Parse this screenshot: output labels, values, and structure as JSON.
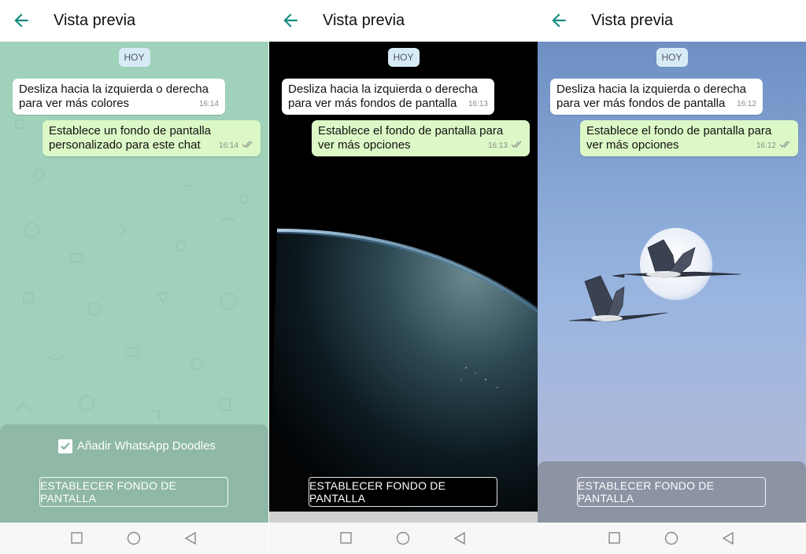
{
  "header": {
    "title": "Vista previa"
  },
  "day_chip": "HOY",
  "panels": [
    {
      "incoming": {
        "line1": "Desliza hacia la izquierda o derecha",
        "line2": "para ver más colores",
        "time": "16:14"
      },
      "outgoing": {
        "line1": "Establece un fondo de pantalla",
        "line2": "personalizado para este chat",
        "time": "16:14"
      },
      "doodles_label": "Añadir WhatsApp Doodles",
      "doodles_checked": true,
      "button": "ESTABLECER FONDO DE PANTALLA"
    },
    {
      "incoming": {
        "line1": "Desliza hacia la izquierda o derecha",
        "line2": "para ver más fondos de pantalla",
        "time": "16:13"
      },
      "outgoing": {
        "line1": "Establece el fondo de pantalla para",
        "line2": "ver más opciones",
        "time": "16:13"
      },
      "button": "ESTABLECER FONDO DE PANTALLA"
    },
    {
      "incoming": {
        "line1": "Desliza hacia la izquierda o derecha",
        "line2": "para ver más fondos de pantalla",
        "time": "16:12"
      },
      "outgoing": {
        "line1": "Establece el fondo de pantalla para",
        "line2": "ver más opciones",
        "time": "16:12"
      },
      "button": "ESTABLECER FONDO DE PANTALLA"
    }
  ],
  "icons": {
    "back": "arrow-left-icon",
    "nav": [
      "square-recents-icon",
      "circle-home-icon",
      "triangle-back-icon"
    ]
  },
  "colors": {
    "accent": "#128c7e",
    "incoming_bubble": "#ffffff",
    "outgoing_bubble": "#dcf8c6",
    "panel1_wallpaper": "#9fd1bb"
  }
}
